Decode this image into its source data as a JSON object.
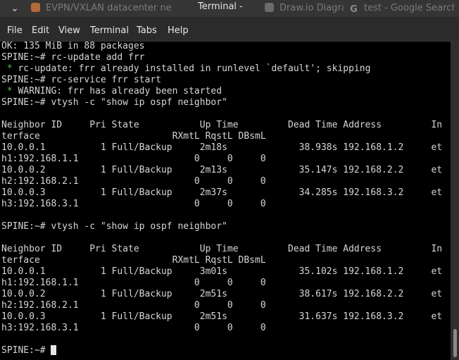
{
  "window": {
    "title": "Terminal -",
    "bg_tabs": [
      {
        "label": "EVPN/VXLAN datacenter ne"
      },
      {
        "label": "Draw.io Diagrams | UML, Fl"
      },
      {
        "label": "test - Google Search"
      }
    ]
  },
  "menu": [
    "File",
    "Edit",
    "View",
    "Terminal",
    "Tabs",
    "Help"
  ],
  "terminal": {
    "lines": [
      "OK: 135 MiB in 88 packages",
      "SPINE:~# rc-update add frr",
      " * rc-update: frr already installed in runlevel `default'; skipping",
      "SPINE:~# rc-service frr start",
      " * WARNING: frr has already been started",
      "SPINE:~# vtysh -c \"show ip ospf neighbor\"",
      "",
      "Neighbor ID     Pri State           Up Time         Dead Time Address         In",
      "terface                        RXmtL RqstL DBsmL",
      "10.0.0.1          1 Full/Backup     2m18s             38.938s 192.168.1.2     et",
      "h1:192.168.1.1                     0     0     0",
      "10.0.0.2          1 Full/Backup     2m13s             35.147s 192.168.2.2     et",
      "h2:192.168.2.1                     0     0     0",
      "10.0.0.3          1 Full/Backup     2m37s             34.285s 192.168.3.2     et",
      "h3:192.168.3.1                     0     0     0",
      "",
      "SPINE:~# vtysh -c \"show ip ospf neighbor\"",
      "",
      "Neighbor ID     Pri State           Up Time         Dead Time Address         In",
      "terface                        RXmtL RqstL DBsmL",
      "10.0.0.1          1 Full/Backup     3m01s             35.102s 192.168.1.2     et",
      "h1:192.168.1.1                     0     0     0",
      "10.0.0.2          1 Full/Backup     2m51s             38.617s 192.168.2.2     et",
      "h2:192.168.2.1                     0     0     0",
      "10.0.0.3          1 Full/Backup     2m51s             31.637s 192.168.3.2     et",
      "h3:192.168.3.1                     0     0     0",
      "",
      "SPINE:~# "
    ]
  },
  "colors": {
    "terminal_bg": "#000000",
    "terminal_fg": "#d6d6d6",
    "bullet_green": "#4fc44f"
  }
}
